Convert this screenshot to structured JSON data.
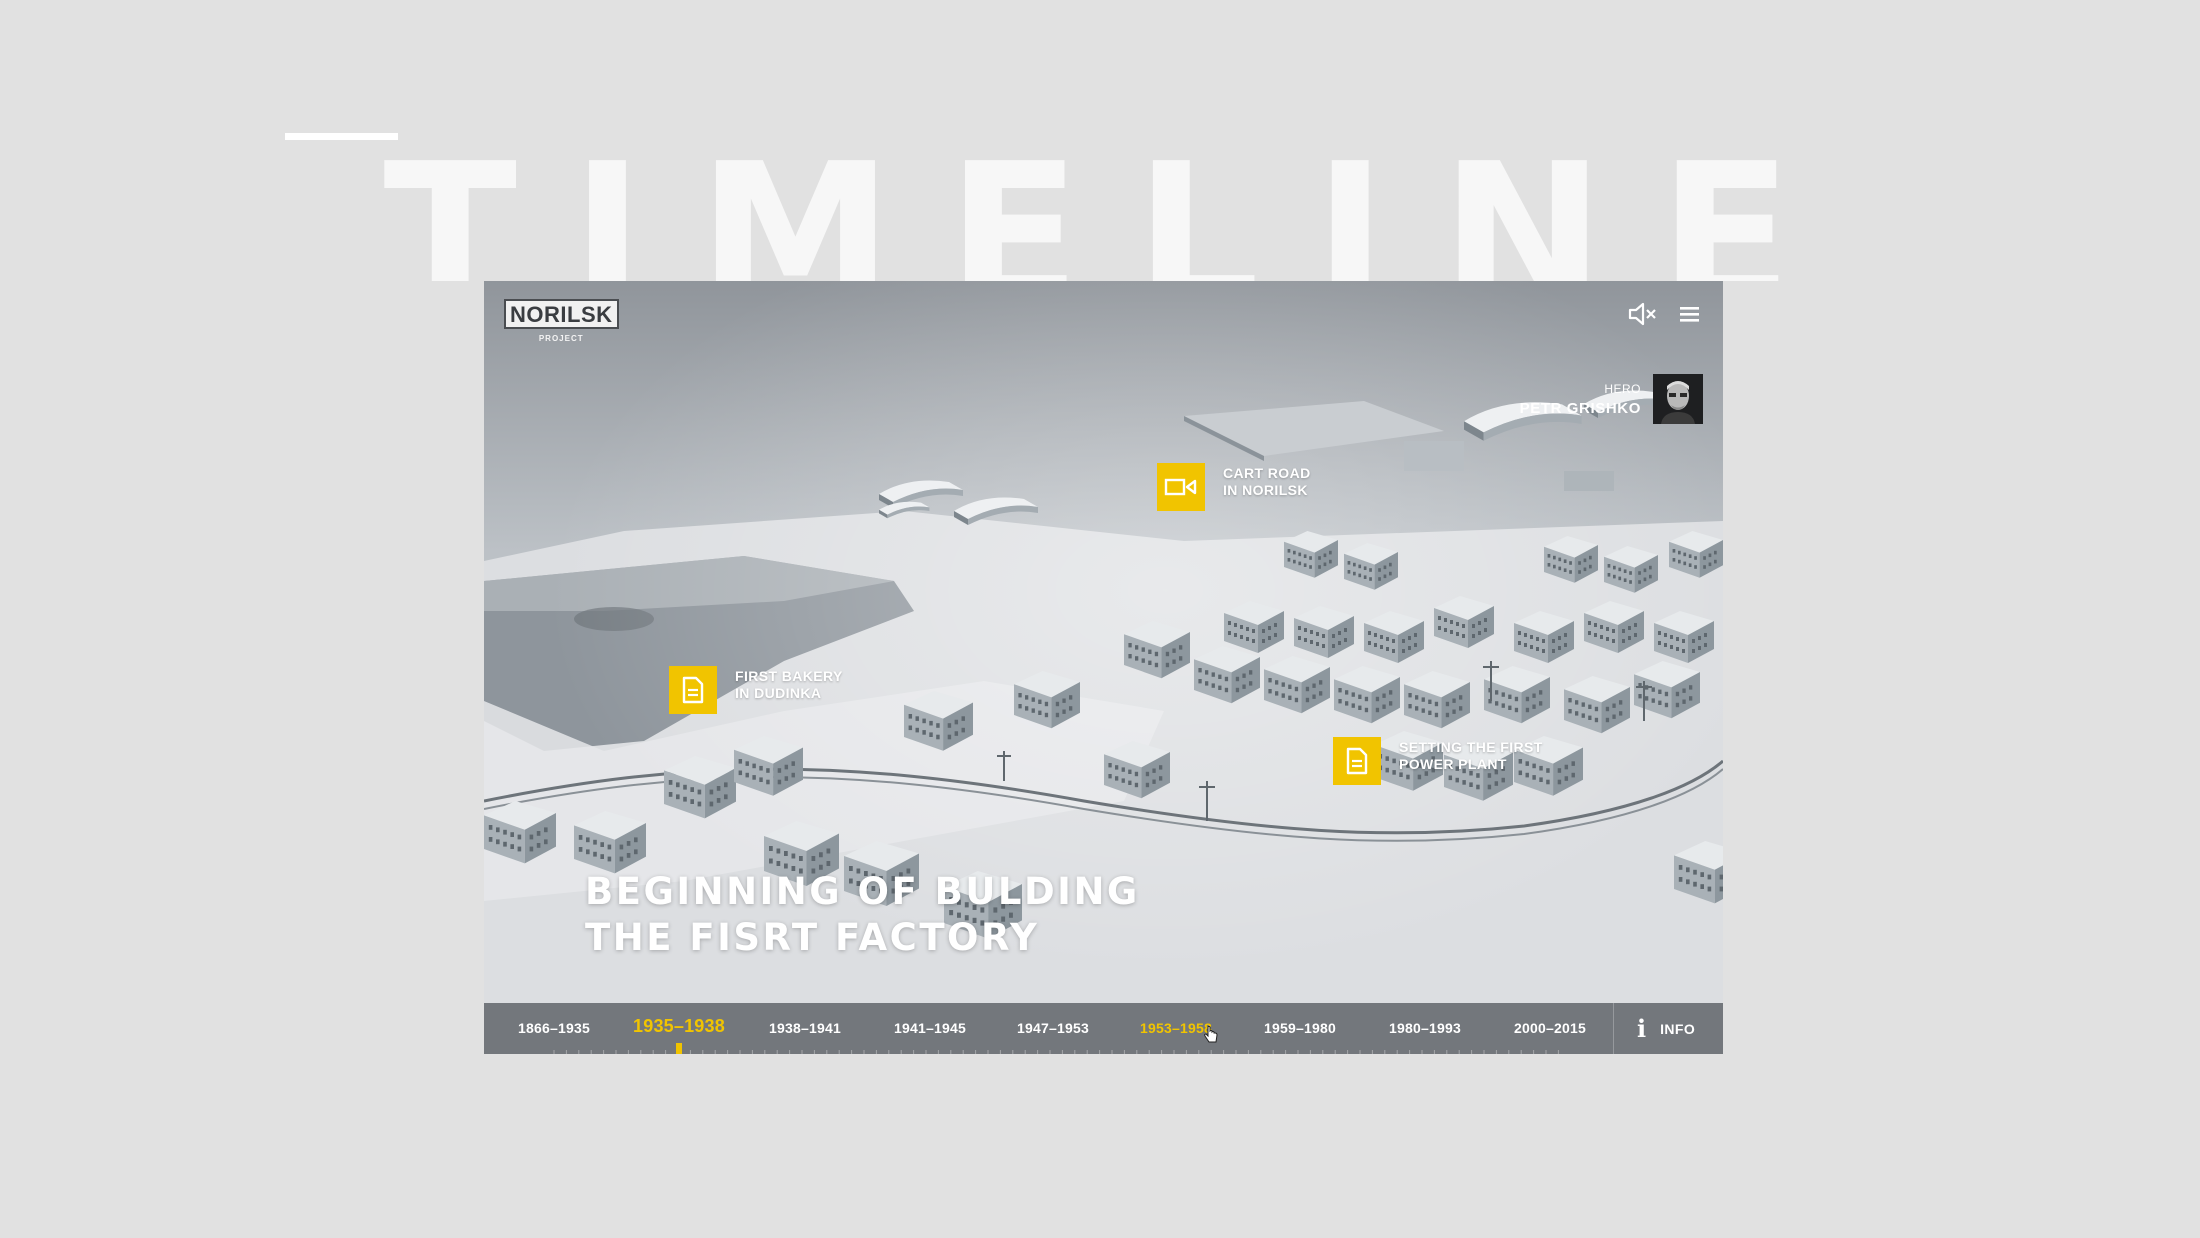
{
  "page": {
    "title": "TIMELINE"
  },
  "header": {
    "logo_text": "NORILSK",
    "logo_sub": "PROJECT",
    "icons": [
      "sound-muted-icon",
      "menu-icon"
    ]
  },
  "hero": {
    "label": "HERO",
    "name": "PETR GRISHKO"
  },
  "hotspots": [
    {
      "type": "video",
      "line1": "CART ROAD",
      "line2": "IN NORILSK"
    },
    {
      "type": "document",
      "line1": "FIRST BAKERY",
      "line2": "IN DUDINKA"
    },
    {
      "type": "document",
      "line1": "SETTING THE FIRST",
      "line2": "POWER PLANT"
    }
  ],
  "headline": {
    "line1": "BEGINNING OF BULDING",
    "line2": "THE FISRT FACTORY"
  },
  "timeline": {
    "periods": [
      {
        "label": "1866–1935",
        "state": "normal"
      },
      {
        "label": "1935–1938",
        "state": "active"
      },
      {
        "label": "1938–1941",
        "state": "normal"
      },
      {
        "label": "1941–1945",
        "state": "normal"
      },
      {
        "label": "1947–1953",
        "state": "normal"
      },
      {
        "label": "1953–1958",
        "state": "hover"
      },
      {
        "label": "1959–1980",
        "state": "normal"
      },
      {
        "label": "1980–1993",
        "state": "normal"
      },
      {
        "label": "2000–2015",
        "state": "normal"
      }
    ],
    "info_label": "INFO"
  },
  "colors": {
    "accent": "#f1c400",
    "background": "#e1e1e1",
    "bar": "#5c6065"
  }
}
